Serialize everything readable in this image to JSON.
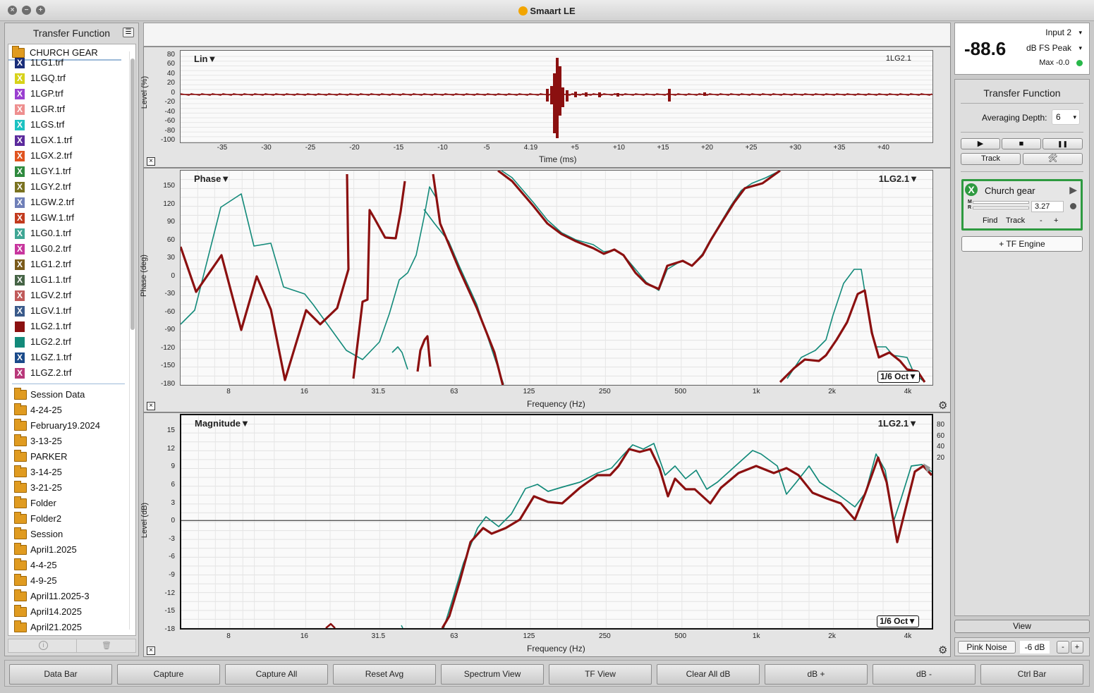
{
  "window": {
    "title": "Smaart LE"
  },
  "left_panel": {
    "header": "Transfer Function",
    "group": "CHURCH GEAR",
    "files": [
      {
        "label": "1LG1.trf",
        "color": "#1a2e7a",
        "glyph": "X"
      },
      {
        "label": "1LGQ.trf",
        "color": "#d7d21a",
        "glyph": "X"
      },
      {
        "label": "1LGP.trf",
        "color": "#9a3fd0",
        "glyph": "X"
      },
      {
        "label": "1LGR.trf",
        "color": "#ee8f8f",
        "glyph": "X"
      },
      {
        "label": "1LGS.trf",
        "color": "#1cc2c2",
        "glyph": "X"
      },
      {
        "label": "1LGX.1.trf",
        "color": "#5b2a9c",
        "glyph": "X"
      },
      {
        "label": "1LGX.2.trf",
        "color": "#e05420",
        "glyph": "X"
      },
      {
        "label": "1LGY.1.trf",
        "color": "#2f8a3e",
        "glyph": "X"
      },
      {
        "label": "1LGY.2.trf",
        "color": "#7a7220",
        "glyph": "X"
      },
      {
        "label": "1LGW.2.trf",
        "color": "#6f7fb8",
        "glyph": "X"
      },
      {
        "label": "1LGW.1.trf",
        "color": "#c23a1e",
        "glyph": "X"
      },
      {
        "label": "1LG0.1.trf",
        "color": "#3fa694",
        "glyph": "X"
      },
      {
        "label": "1LG0.2.trf",
        "color": "#c8369e",
        "glyph": "X"
      },
      {
        "label": "1LG1.2.trf",
        "color": "#7a5a1a",
        "glyph": "X"
      },
      {
        "label": "1LG1.1.trf",
        "color": "#466446",
        "glyph": "X"
      },
      {
        "label": "1LGV.2.trf",
        "color": "#c05a5a",
        "glyph": "X"
      },
      {
        "label": "1LGV.1.trf",
        "color": "#3a5a8a",
        "glyph": "X"
      },
      {
        "label": "1LG2.1.trf",
        "color": "#8b1010",
        "glyph": ""
      },
      {
        "label": "1LG2.2.trf",
        "color": "#138a7a",
        "glyph": ""
      },
      {
        "label": "1LGZ.1.trf",
        "color": "#1a4a8a",
        "glyph": "X"
      },
      {
        "label": "1LGZ.2.trf",
        "color": "#b8387a",
        "glyph": "X"
      }
    ],
    "folders": [
      "Session Data",
      "4-24-25",
      "February19.2024",
      "3-13-25",
      "PARKER",
      "3-14-25",
      "3-21-25",
      "Folder",
      "Folder2",
      "Session",
      "April1.2025",
      "4-4-25",
      "4-9-25",
      "April11.2025-3",
      "April14.2025",
      "April21.2025"
    ],
    "footer_info_icon": "i",
    "footer_trash_icon": "🗑"
  },
  "impulse_plot": {
    "label": "Lin▼",
    "trace_name": "1LG2.1",
    "y_axis_label": "Level (%)",
    "x_axis_label": "Time (ms)",
    "y_ticks": [
      "80",
      "60",
      "40",
      "20",
      "0",
      "-20",
      "-40",
      "-60",
      "-80",
      "-100"
    ],
    "x_ticks": [
      "-35",
      "-30",
      "-25",
      "-20",
      "-15",
      "-10",
      "-5",
      "4.19",
      "+5",
      "+10",
      "+15",
      "+20",
      "+25",
      "+30",
      "+35",
      "+40"
    ]
  },
  "phase_plot": {
    "label": "Phase▼",
    "trace_name": "1LG2.1▼",
    "y_axis_label": "Phase (deg)",
    "x_axis_label": "Frequency (Hz)",
    "smoothing": "1/6 Oct▼",
    "y_ticks": [
      "150",
      "120",
      "90",
      "60",
      "30",
      "0",
      "-30",
      "-60",
      "-90",
      "-120",
      "-150",
      "-180"
    ],
    "x_ticks": [
      "8",
      "16",
      "31.5",
      "63",
      "125",
      "250",
      "500",
      "1k",
      "2k",
      "4k"
    ]
  },
  "magnitude_plot": {
    "label": "Magnitude▼",
    "trace_name": "1LG2.1▼",
    "y_axis_label": "Level (dB)",
    "x_axis_label": "Frequency (Hz)",
    "smoothing": "1/6 Oct▼",
    "y_ticks": [
      "15",
      "12",
      "9",
      "6",
      "3",
      "0",
      "-3",
      "-6",
      "-9",
      "-12",
      "-15",
      "-18"
    ],
    "x_ticks": [
      "8",
      "16",
      "31.5",
      "63",
      "125",
      "250",
      "500",
      "1k",
      "2k",
      "4k"
    ],
    "coherence_ticks": [
      "80",
      "60",
      "40",
      "20"
    ]
  },
  "meter": {
    "value": "-88.6",
    "input": "Input 2",
    "mode": "dB FS Peak",
    "max": "Max -0.0",
    "status_color": "#28b84a"
  },
  "right_panel": {
    "title": "Transfer Function",
    "averaging_label": "Averaging Depth:",
    "averaging_value": "6",
    "play_icon": "▶",
    "stop_icon": "■",
    "pause_icon": "❚❚",
    "track_label": "Track",
    "tools_icon": "🛠",
    "engine": {
      "name": "Church gear",
      "delay": "3.27",
      "m_label": "M",
      "r_label": "R",
      "find_label": "Find",
      "track_label": "Track",
      "minus": "-",
      "plus": "+",
      "accent": "#2e9a40"
    },
    "add_engine": "+ TF Engine",
    "view_label": "View",
    "pink_noise_label": "Pink Noise",
    "pink_level": "-6 dB",
    "pink_minus": "-",
    "pink_plus": "+"
  },
  "bottom_bar": [
    "Data Bar",
    "Capture",
    "Capture All",
    "Reset Avg",
    "Spectrum View",
    "TF View",
    "Clear All dB",
    "dB +",
    "dB -",
    "Ctrl Bar"
  ],
  "colors": {
    "trace_primary": "#8b1010",
    "trace_secondary": "#138a7a"
  }
}
